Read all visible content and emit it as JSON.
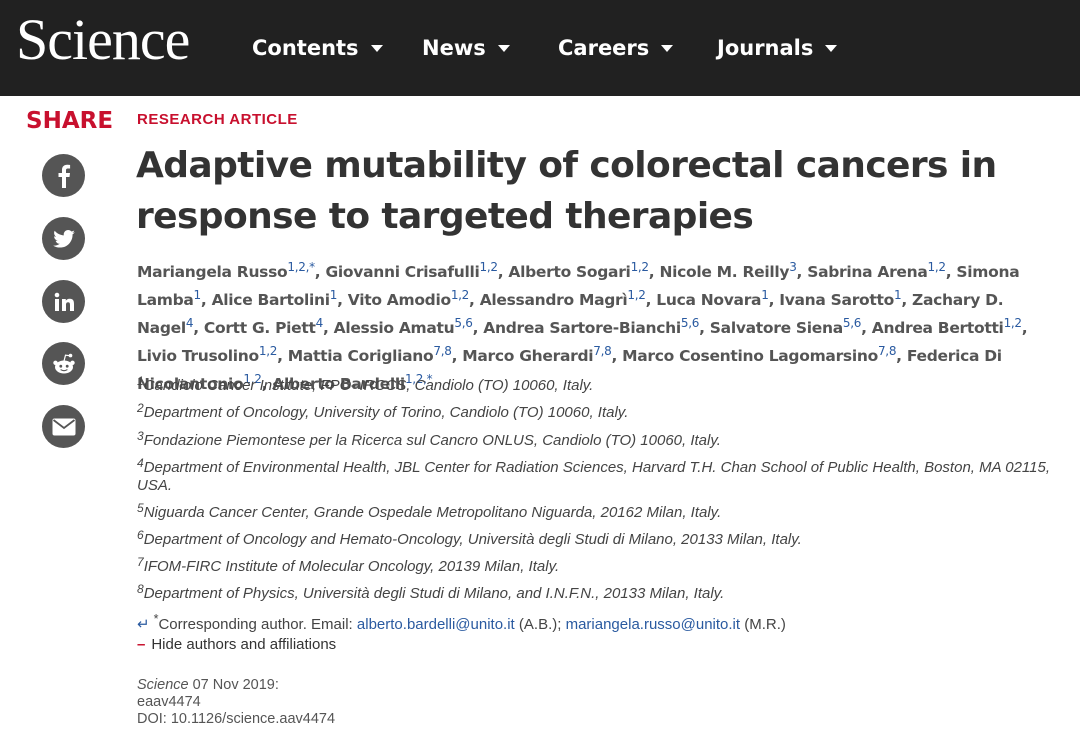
{
  "header": {
    "logo": "Science",
    "nav": [
      {
        "label": "Contents"
      },
      {
        "label": "News"
      },
      {
        "label": "Careers"
      },
      {
        "label": "Journals"
      }
    ]
  },
  "share": {
    "label": "SHARE",
    "icons": [
      "facebook-icon",
      "twitter-icon",
      "linkedin-icon",
      "reddit-icon",
      "email-icon"
    ]
  },
  "article": {
    "kicker": "RESEARCH ARTICLE",
    "title": "Adaptive mutability of colorectal cancers in response to targeted therapies",
    "authors": [
      {
        "name": "Mariangela Russo",
        "sup": "1,2,*"
      },
      {
        "name": "Giovanni Crisafulli",
        "sup": "1,2"
      },
      {
        "name": "Alberto Sogari",
        "sup": "1,2"
      },
      {
        "name": "Nicole M. Reilly",
        "sup": "3"
      },
      {
        "name": "Sabrina Arena",
        "sup": "1,2"
      },
      {
        "name": "Simona Lamba",
        "sup": "1"
      },
      {
        "name": "Alice Bartolini",
        "sup": "1"
      },
      {
        "name": "Vito Amodio",
        "sup": "1,2"
      },
      {
        "name": "Alessandro Magrì",
        "sup": "1,2"
      },
      {
        "name": "Luca Novara",
        "sup": "1"
      },
      {
        "name": "Ivana Sarotto",
        "sup": "1"
      },
      {
        "name": "Zachary D. Nagel",
        "sup": "4"
      },
      {
        "name": "Cortt G. Piett",
        "sup": "4"
      },
      {
        "name": "Alessio Amatu",
        "sup": "5,6"
      },
      {
        "name": "Andrea Sartore-Bianchi",
        "sup": "5,6"
      },
      {
        "name": "Salvatore Siena",
        "sup": "5,6"
      },
      {
        "name": "Andrea Bertotti",
        "sup": "1,2"
      },
      {
        "name": "Livio Trusolino",
        "sup": "1,2"
      },
      {
        "name": "Mattia Corigliano",
        "sup": "7,8"
      },
      {
        "name": "Marco Gherardi",
        "sup": "7,8"
      },
      {
        "name": "Marco Cosentino Lagomarsino",
        "sup": "7,8"
      },
      {
        "name": "Federica Di Nicolantonio",
        "sup": "1,2"
      },
      {
        "name": "Alberto Bardelli",
        "sup": "1,2,*"
      }
    ],
    "affiliations": [
      {
        "num": "1",
        "text": "Candiolo Cancer Institute, FPO–IRCCS, Candiolo (TO) 10060, Italy."
      },
      {
        "num": "2",
        "text": "Department of Oncology, University of Torino, Candiolo (TO) 10060, Italy."
      },
      {
        "num": "3",
        "text": "Fondazione Piemontese per la Ricerca sul Cancro ONLUS, Candiolo (TO) 10060, Italy."
      },
      {
        "num": "4",
        "text": "Department of Environmental Health, JBL Center for Radiation Sciences, Harvard T.H. Chan School of Public Health, Boston, MA 02115, USA."
      },
      {
        "num": "5",
        "text": "Niguarda Cancer Center, Grande Ospedale Metropolitano Niguarda, 20162 Milan, Italy."
      },
      {
        "num": "6",
        "text": "Department of Oncology and Hemato-Oncology, Università degli Studi di Milano, 20133 Milan, Italy."
      },
      {
        "num": "7",
        "text": "IFOM-FIRC Institute of Molecular Oncology, 20139 Milan, Italy."
      },
      {
        "num": "8",
        "text": "Department of Physics, Università degli Studi di Milano, and I.N.F.N., 20133 Milan, Italy."
      }
    ],
    "corresponding": {
      "return_glyph": "↵",
      "star": "*",
      "prefix": "Corresponding author. Email: ",
      "email1": "alberto.bardelli@unito.it",
      "initials1": " (A.B.); ",
      "email2": "mariangela.russo@unito.it",
      "initials2": " (M.R.)"
    },
    "hide_authors": {
      "minus": "–",
      "label": "Hide authors and affiliations"
    },
    "meta": {
      "journal": "Science",
      "date": " 07 Nov 2019:",
      "article_id": "eaav4474",
      "doi": "DOI: 10.1126/science.aav4474"
    }
  },
  "colors": {
    "header_bg": "#212121",
    "accent_red": "#c8102e",
    "link_blue": "#2a5aa0",
    "share_icon_bg": "#555555"
  }
}
